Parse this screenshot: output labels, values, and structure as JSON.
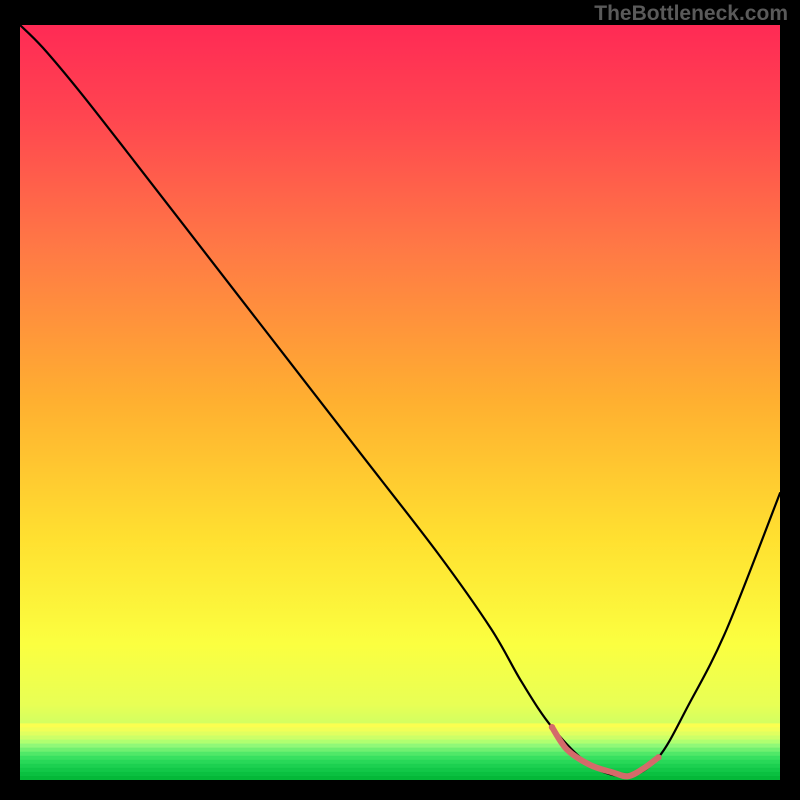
{
  "watermark": "TheBottleneck.com",
  "chart_data": {
    "type": "line",
    "title": "",
    "xlabel": "",
    "ylabel": "",
    "xlim": [
      0,
      100
    ],
    "ylim": [
      0,
      100
    ],
    "gradient_stops": [
      {
        "offset": 0,
        "color": "#ff2a55"
      },
      {
        "offset": 0.12,
        "color": "#ff4550"
      },
      {
        "offset": 0.3,
        "color": "#ff7a45"
      },
      {
        "offset": 0.5,
        "color": "#ffb030"
      },
      {
        "offset": 0.68,
        "color": "#ffe030"
      },
      {
        "offset": 0.82,
        "color": "#fbff40"
      },
      {
        "offset": 0.9,
        "color": "#e8ff55"
      },
      {
        "offset": 0.955,
        "color": "#b8ff70"
      },
      {
        "offset": 0.985,
        "color": "#60e860"
      },
      {
        "offset": 1.0,
        "color": "#18c850"
      }
    ],
    "series": [
      {
        "name": "bottleneck-curve",
        "stroke": "#000000",
        "stroke_width": 2.2,
        "x": [
          0,
          3,
          8,
          15,
          25,
          35,
          45,
          55,
          62,
          66,
          70,
          75,
          80,
          84,
          88,
          93,
          100
        ],
        "y": [
          100,
          97,
          91,
          82,
          69,
          56,
          43,
          30,
          20,
          13,
          7,
          2,
          0.5,
          3,
          10,
          20,
          38
        ]
      }
    ],
    "flat_highlight": {
      "stroke": "#d46a6a",
      "stroke_width": 6,
      "x": [
        70,
        72,
        75,
        78,
        80,
        82,
        84
      ],
      "y": [
        7,
        4,
        2,
        1,
        0.5,
        1.5,
        3
      ]
    },
    "tail_stripes": {
      "count": 14,
      "y_start": 92.5,
      "y_end": 100,
      "colors": [
        "#fbff50",
        "#f0ff58",
        "#e0ff60",
        "#ccff68",
        "#b0ff70",
        "#90f878",
        "#70f070",
        "#50e868",
        "#38e060",
        "#28d858",
        "#1cd050",
        "#12c848",
        "#0ac040",
        "#04b838"
      ]
    }
  }
}
